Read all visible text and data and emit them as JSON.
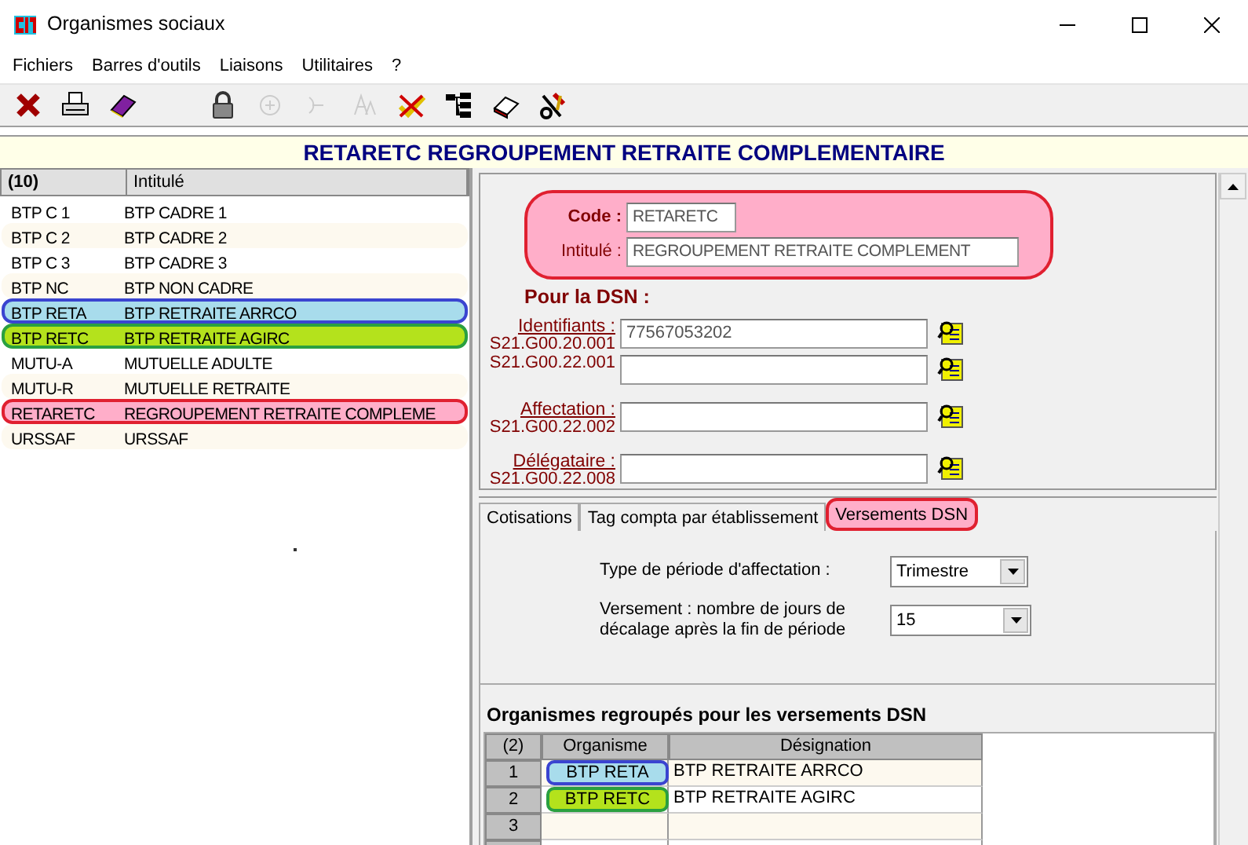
{
  "window": {
    "title": "Organismes sociaux"
  },
  "menu": [
    "Fichiers",
    "Barres d'outils",
    "Liaisons",
    "Utilitaires",
    "?"
  ],
  "toolbar": [
    {
      "kind": "close",
      "disabled": false
    },
    {
      "kind": "print",
      "disabled": false
    },
    {
      "kind": "book",
      "disabled": false
    },
    {
      "kind": "gap"
    },
    {
      "kind": "lock",
      "disabled": false
    },
    {
      "kind": "plus",
      "disabled": true
    },
    {
      "kind": "minus",
      "disabled": true
    },
    {
      "kind": "letters",
      "disabled": true
    },
    {
      "kind": "cross",
      "disabled": false
    },
    {
      "kind": "tree",
      "disabled": false
    },
    {
      "kind": "eraser",
      "disabled": false
    },
    {
      "kind": "tools",
      "disabled": false
    }
  ],
  "header": {
    "title": "RETARETC REGROUPEMENT RETRAITE COMPLEMENTAIRE"
  },
  "list": {
    "columns": [
      "(10)",
      "Intitulé"
    ],
    "rows": [
      {
        "code": "BTP C 1",
        "label": "BTP CADRE 1"
      },
      {
        "code": "BTP C 2",
        "label": "BTP CADRE 2"
      },
      {
        "code": "BTP C 3",
        "label": "BTP CADRE 3"
      },
      {
        "code": "BTP NC",
        "label": "BTP NON CADRE"
      },
      {
        "code": "BTP RETA",
        "label": "BTP RETRAITE ARRCO",
        "color": "#3a44d0"
      },
      {
        "code": "BTP RETC",
        "label": "BTP RETRAITE AGIRC",
        "color": "#2aa040"
      },
      {
        "code": "MUTU-A",
        "label": "MUTUELLE ADULTE"
      },
      {
        "code": "MUTU-R",
        "label": "MUTUELLE RETRAITE"
      },
      {
        "code": "RETARETC",
        "label": "REGROUPEMENT RETRAITE COMPLEME",
        "color": "#e02030"
      },
      {
        "code": "URSSAF",
        "label": "URSSAF"
      }
    ]
  },
  "detail": {
    "color": "#e02030",
    "code": {
      "label": "Code :",
      "value": "RETARETC"
    },
    "intitule": {
      "label": "Intitulé :",
      "value": "REGROUPEMENT RETRAITE COMPLEMENT"
    },
    "dsn_heading": "Pour la DSN :",
    "fields": [
      {
        "label": "Identifiants :",
        "code": "S21.G00.20.001",
        "value": "77567053202"
      },
      {
        "code": "S21.G00.22.001"
      },
      {
        "label": "Affectation :",
        "code": "S21.G00.22.002"
      },
      {
        "label": "Délégataire :",
        "code": "S21.G00.22.008"
      }
    ]
  },
  "tabs": [
    {
      "label": "Cotisations",
      "selected": false
    },
    {
      "label": "Tag compta par établissement",
      "selected": false
    },
    {
      "label": "Versements DSN",
      "selected": true,
      "color": "#e02030"
    }
  ],
  "versements": {
    "periode": {
      "label": "Type de période d'affectation :",
      "value": "Trimestre"
    },
    "decalage": {
      "label": "Versement : nombre de jours de décalage après la fin de période",
      "value": "15"
    },
    "group_heading": "Organismes regroupés pour les versements DSN",
    "grid": {
      "columns": [
        "(2)",
        "Organisme",
        "Désignation"
      ],
      "rows": [
        {
          "number": "1",
          "organisme": "BTP RETA",
          "designation": "BTP RETRAITE ARRCO",
          "color": "#3a44d0"
        },
        {
          "number": "2",
          "organisme": "BTP RETC",
          "designation": "BTP RETRAITE AGIRC",
          "color": "#2aa040"
        },
        {
          "number": "3"
        }
      ]
    }
  }
}
